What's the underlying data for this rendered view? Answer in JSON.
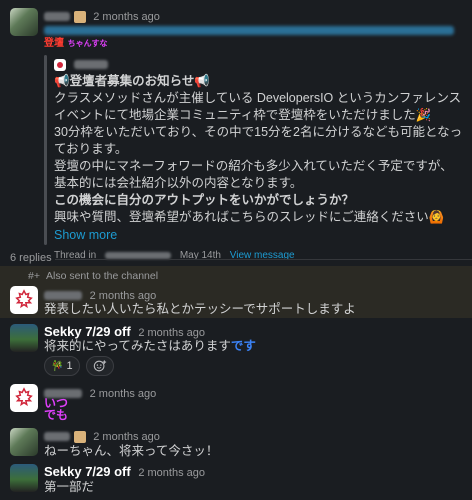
{
  "parent": {
    "timestamp": "2 months ago",
    "stamp_text": [
      "登壇",
      "ちゃんすな"
    ],
    "shared": {
      "title": "📢登壇者募集のお知らせ📢",
      "lines": [
        "クラスメソッドさんが主催している DevelopersIO というカンファレンスイベントにて地場企業コミュニティ枠で登壇枠をいただけました🎉",
        "30分枠をいただいており、その中で15分を2名に分けるなども可能となっております。",
        "登壇の中にマネーフォワードの紹介も多少入れていただく予定ですが、基本的には会社紹介以外の内容となります。"
      ],
      "bold_line": "この機会に自分のアウトプットをいかがでしょうか？",
      "last_line": "興味や質問、登壇希望があればこちらのスレッドにご連絡ください🙆",
      "show_more": "Show more",
      "footer_prefix": "Thread in",
      "footer_date": "May 14th",
      "footer_link": "View message"
    }
  },
  "replies_label": "6 replies",
  "also_sent": "Also sent to the channel",
  "replies": [
    {
      "name": "",
      "time": "2 months ago",
      "text": "発表したい人いたら私とかテッシーでサポートしますよ"
    },
    {
      "name": "Sekky 7/29 off",
      "time": "2 months ago",
      "text": "将来的にやってみたさはあります",
      "stamp": "です",
      "reactions": [
        {
          "emoji": "🎋",
          "count": "1"
        }
      ]
    },
    {
      "name": "",
      "time": "2 months ago",
      "stamp_text": [
        "いつ",
        "でも"
      ]
    },
    {
      "name": "",
      "time": "2 months ago",
      "text": "ねーちゃん、将来って今さッ！"
    },
    {
      "name": "Sekky 7/29 off",
      "time": "2 months ago",
      "text": "第一部だ"
    }
  ],
  "colors": {
    "background": "#1a1d21",
    "link": "#1d9bd1",
    "highlight": "#2b2a24"
  }
}
